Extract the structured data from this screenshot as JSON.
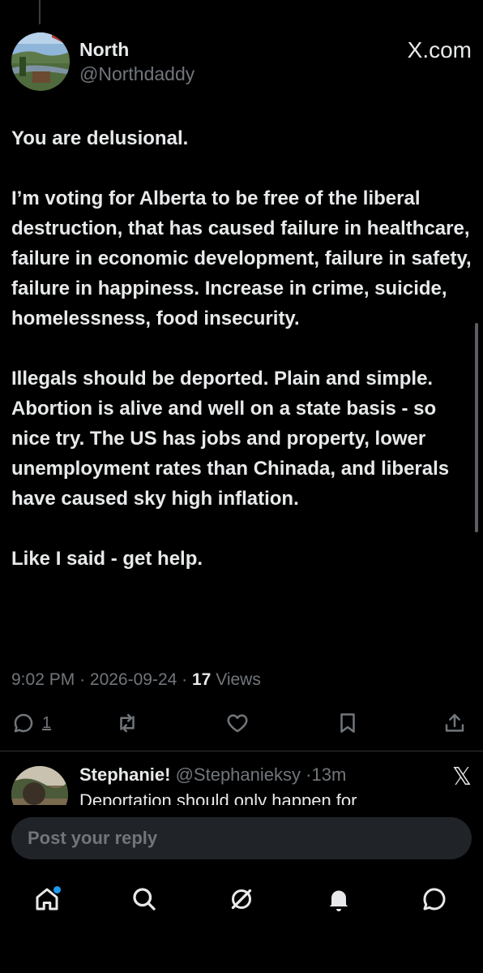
{
  "author": {
    "name": "North",
    "handle": "@Northdaddy"
  },
  "brand": "X.com",
  "post": {
    "paragraphs": [
      "You are delusional.",
      "I’m voting for Alberta to be free of the liberal destruction, that has caused failure in healthcare, failure in economic development, failure in safety, failure in happiness.  Increase in crime, suicide, homelessness, food insecurity.",
      "Illegals should be deported.  Plain and simple.  Abortion is alive and well on a state basis - so nice try.  The US has jobs and property, lower unemployment rates than Chinada, and liberals have caused sky high inflation.",
      "Like I said - get help."
    ],
    "time": "9:02 PM",
    "date": "2026-09-24",
    "views_count": "17",
    "views_label": "Views"
  },
  "actions": {
    "reply_count": "1"
  },
  "reply": {
    "name": "Stephanie!",
    "handle": "@Stephanieksy",
    "age": "13m",
    "text": "Deportation should only happen for"
  },
  "reply_box": {
    "placeholder": "Post your reply"
  },
  "icons": [
    "reply-icon",
    "repost-icon",
    "like-icon",
    "bookmark-icon",
    "share-icon",
    "home-icon",
    "search-icon",
    "grok-icon",
    "notifications-icon",
    "messages-icon"
  ],
  "colors": {
    "background": "#000000",
    "text": "#e7e9ea",
    "muted": "#71767b",
    "accent": "#1d9bf0"
  }
}
